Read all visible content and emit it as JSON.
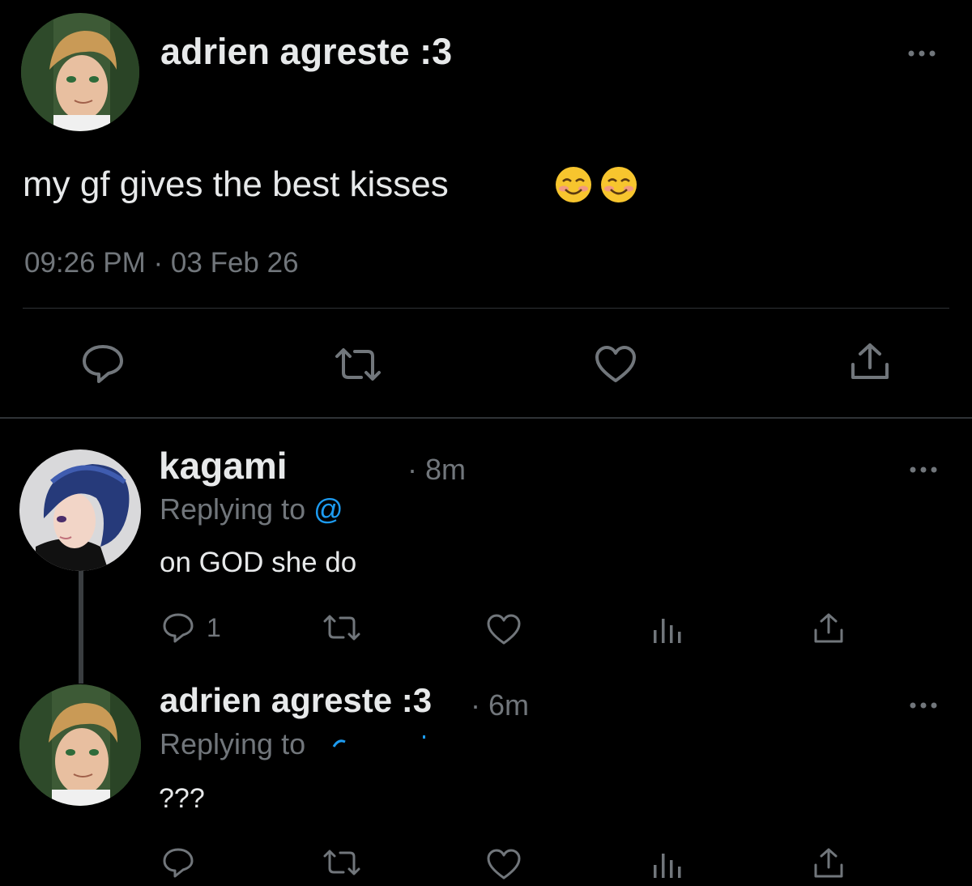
{
  "main_post": {
    "author": "adrien agreste :3",
    "text": "my gf gives the best kisses",
    "emoji": "😊 😊",
    "timestamp": "09:26 PM · 03 Feb 26"
  },
  "replies": [
    {
      "author": "kagami",
      "time": "· 8m",
      "replying_to_label": "Replying to",
      "handle": "@",
      "text": "on GOD she do",
      "reply_count": "1"
    },
    {
      "author": "adrien agreste :3",
      "time": "· 6m",
      "replying_to_label": "Replying to",
      "handle": "",
      "text": "???"
    }
  ],
  "colors": {
    "background": "#000000",
    "text": "#e7e9ea",
    "secondary": "#71767b",
    "link": "#1d9bf0",
    "divider": "#2f3336"
  },
  "icons": [
    "more-icon",
    "reply-icon",
    "retweet-icon",
    "like-icon",
    "share-icon",
    "views-icon"
  ]
}
